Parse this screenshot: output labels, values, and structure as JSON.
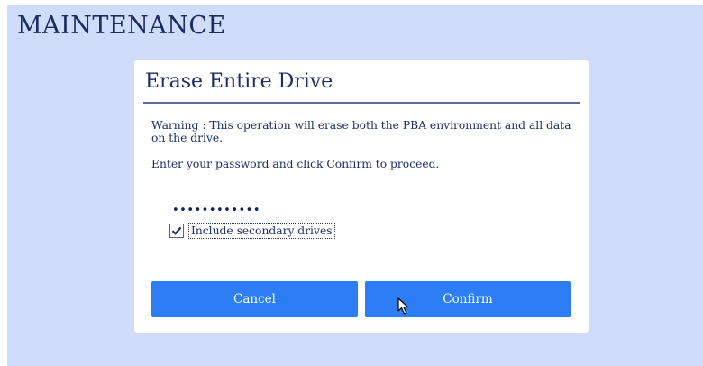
{
  "page": {
    "title": "MAINTENANCE"
  },
  "dialog": {
    "title": "Erase Entire Drive",
    "warning": "Warning : This operation will erase both the PBA environment and all data on the drive.",
    "instruction": "Enter your password and click Confirm to proceed.",
    "password_value": "••••••••••••",
    "checkbox": {
      "label": "Include secondary drives",
      "checked": true
    },
    "buttons": {
      "cancel": "Cancel",
      "confirm": "Confirm"
    }
  },
  "icons": {
    "check": "checkmark-icon",
    "cursor": "mouse-pointer-icon"
  },
  "colors": {
    "background": "#cfddfa",
    "text": "#1b2d63",
    "button": "#2d7ef5",
    "button_text": "#ffffff"
  }
}
